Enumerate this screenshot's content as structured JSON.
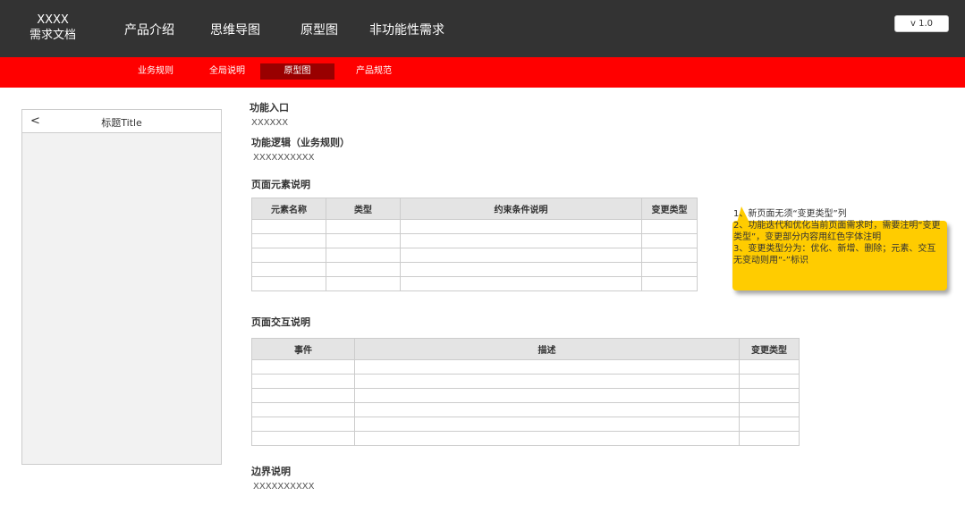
{
  "header": {
    "brand_line1": "XXXX",
    "brand_line2": "需求文档",
    "nav": [
      "产品介绍",
      "思维导图",
      "原型图",
      "非功能性需求"
    ],
    "version": "v 1.0"
  },
  "subnav": {
    "items": [
      "业务规则",
      "全局说明",
      "原型图",
      "产品规范"
    ],
    "active": "原型图"
  },
  "phone": {
    "back": "<",
    "title": "标题Title"
  },
  "sections": {
    "entry_label": "功能入口",
    "entry_value": "XXXXXX",
    "logic_label": "功能逻辑（业务规则）",
    "logic_value": "XXXXXXXXXX",
    "elements_label": "页面元素说明",
    "interaction_label": "页面交互说明",
    "boundary_label": "边界说明",
    "boundary_value": "XXXXXXXXXX"
  },
  "elements_table": {
    "columns": [
      "元素名称",
      "类型",
      "约束条件说明",
      "变更类型"
    ],
    "rows": [
      [
        "",
        "",
        "",
        ""
      ],
      [
        "",
        "",
        "",
        ""
      ],
      [
        "",
        "",
        "",
        ""
      ],
      [
        "",
        "",
        "",
        ""
      ],
      [
        "",
        "",
        "",
        ""
      ]
    ]
  },
  "interaction_table": {
    "columns": [
      "事件",
      "描述",
      "变更类型"
    ],
    "rows": [
      [
        "",
        "",
        ""
      ],
      [
        "",
        "",
        ""
      ],
      [
        "",
        "",
        ""
      ],
      [
        "",
        "",
        ""
      ],
      [
        "",
        "",
        ""
      ],
      [
        "",
        "",
        ""
      ]
    ]
  },
  "note": {
    "lines": [
      "1、新页面无须“变更类型”列",
      "2、功能迭代和优化当前页面需求时，需要注明“变更类型”，变更部分内容用红色字体注明",
      "3、变更类型分为：优化、新增、删除；元素、交互无变动则用“-”标识"
    ],
    "color": "#ffcc00"
  },
  "colors": {
    "header_bg": "#333333",
    "subbar_bg": "#ff0000",
    "active_tab_bg": "#990000"
  }
}
